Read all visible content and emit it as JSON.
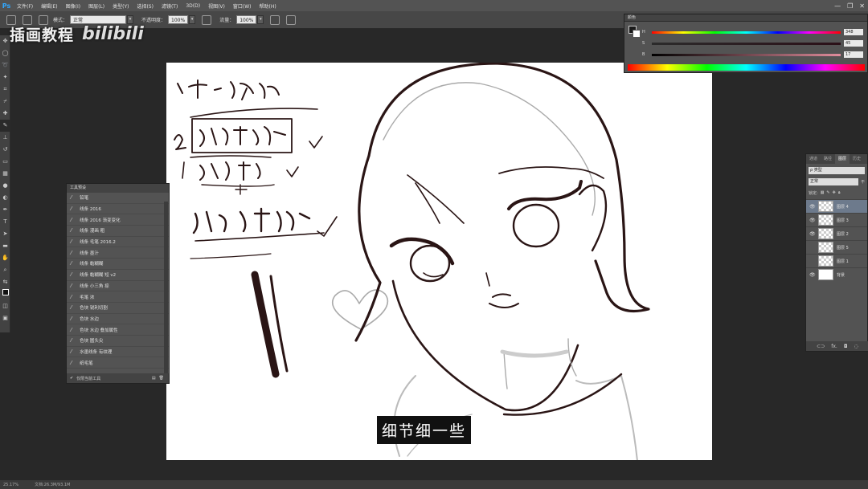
{
  "menubar": {
    "logo": "Ps",
    "items": [
      "文件(F)",
      "编辑(E)",
      "图像(I)",
      "图层(L)",
      "类型(Y)",
      "选择(S)",
      "滤镜(T)",
      "3D(D)",
      "视图(V)",
      "窗口(W)",
      "帮助(H)"
    ],
    "controls": [
      "—",
      "❐",
      "✕"
    ]
  },
  "options": {
    "mode_label": "模式：",
    "mode_value": "正常",
    "opacity_label": "不透明度：",
    "opacity_value": "100%",
    "flow_label": "流量：",
    "flow_value": "100%"
  },
  "watermark": {
    "text": "插画教程",
    "brand": "bilibili"
  },
  "subtitle": "细节细一些",
  "status": {
    "zoom": "25.17%",
    "doc": "文档:26.3M/93.1M"
  },
  "color_panel": {
    "title": "颜色",
    "sliders": [
      {
        "label": "H",
        "value": "348"
      },
      {
        "label": "S",
        "value": "45"
      },
      {
        "label": "B",
        "value": "17"
      }
    ],
    "fg_color": "#1a1a1a"
  },
  "layers_panel": {
    "tabs": [
      "通道",
      "路径",
      "图层",
      "历史"
    ],
    "kind_label": "ρ 类型",
    "blend": "正常",
    "opacity_short": "不",
    "lock_label": "锁定:",
    "layers": [
      {
        "name": "图层 4",
        "visible": true,
        "active": true
      },
      {
        "name": "图层 3",
        "visible": true,
        "active": false
      },
      {
        "name": "图层 2",
        "visible": true,
        "active": false
      },
      {
        "name": "图层 5",
        "visible": false,
        "active": false
      },
      {
        "name": "图层 1",
        "visible": false,
        "active": false
      },
      {
        "name": "背景",
        "visible": true,
        "active": false,
        "solid": true
      }
    ],
    "footer": [
      "⊂⊃",
      "fx.",
      "◘",
      "◌"
    ]
  },
  "presets_panel": {
    "title": "工具预设",
    "items": [
      "铅笔",
      "线条 2016",
      "线条 2016 渐变变化",
      "线条 漫画 粗",
      "线条 毛笔 2016.2",
      "线条 墨汁",
      "线条 黏糊糊",
      "线条 黏糊糊 短 v2",
      "线条 小三角 捺",
      "毛笔 浓",
      "色块 锐利切割",
      "色块 水边",
      "色块 水边 叠加属性",
      "色块 圆头尖",
      "水墨线条 有纹理",
      "纸毛笔"
    ],
    "footer_checkbox": "仅限当前工具"
  },
  "canvas_text": {
    "note1": "1. 干净、流畅",
    "note2": "2. 外边框粗",
    "note3": "细节细",
    "note4": "结构 交接粗"
  }
}
